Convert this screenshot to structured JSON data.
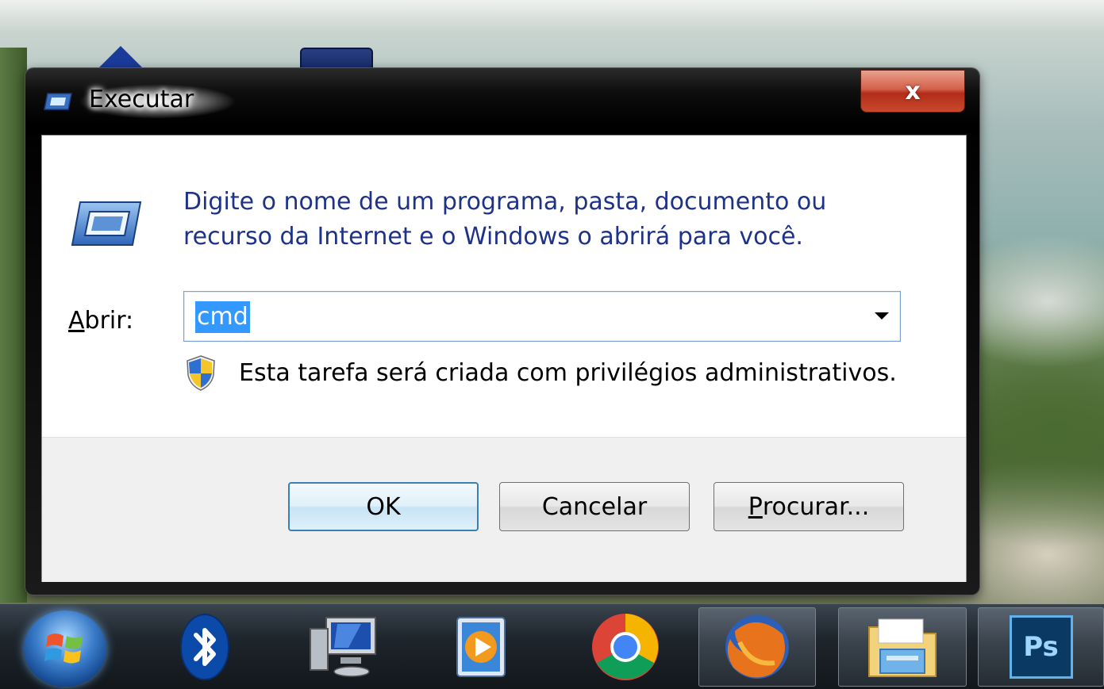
{
  "window": {
    "title": "Executar",
    "close_label": "x"
  },
  "dialog": {
    "description_line1": "Digite o nome de um programa, pasta, documento ou",
    "description_line2": "recurso da Internet e o Windows o abrirá para você.",
    "open_label_accel": "A",
    "open_label_rest": "brir:",
    "open_value": "cmd",
    "admin_notice": "Esta tarefa será criada com privilégios administrativos.",
    "buttons": {
      "ok": "OK",
      "cancel": "Cancelar",
      "browse_accel": "P",
      "browse_rest": "rocurar..."
    }
  },
  "taskbar": {
    "items": [
      {
        "icon": "start-orb-icon"
      },
      {
        "icon": "bluetooth-icon"
      },
      {
        "icon": "network-computer-icon"
      },
      {
        "icon": "media-player-icon"
      },
      {
        "icon": "chrome-icon"
      },
      {
        "icon": "firefox-icon",
        "active": true
      },
      {
        "icon": "windows-explorer-icon",
        "active": true
      },
      {
        "icon": "photoshop-icon",
        "label": "Ps",
        "active": true
      }
    ]
  },
  "colors": {
    "description_text": "#1e3287",
    "selection": "#3399ff",
    "close_button": "#c8492d",
    "ok_border": "#3c7fb1"
  }
}
